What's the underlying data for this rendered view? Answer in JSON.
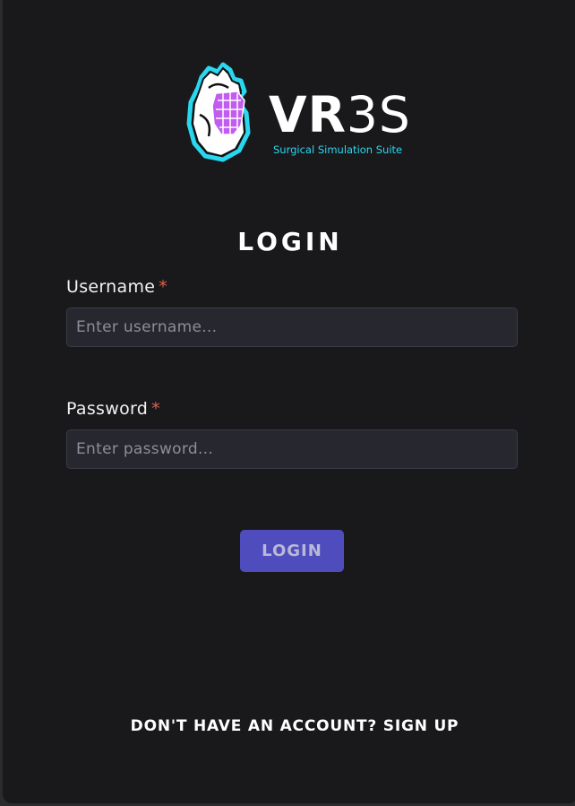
{
  "brand": {
    "logo_main": "VR",
    "logo_number": "3S",
    "tagline": "Surgical Simulation Suite",
    "accent_color": "#29d8f0",
    "heart_color": "#c25bf0"
  },
  "form": {
    "title": "LOGIN",
    "username": {
      "label": "Username",
      "required_mark": "*",
      "placeholder": "Enter username...",
      "value": ""
    },
    "password": {
      "label": "Password",
      "required_mark": "*",
      "placeholder": "Enter password...",
      "value": ""
    },
    "submit_label": "LOGIN",
    "signup_link": "DON'T HAVE AN ACCOUNT? SIGN UP"
  },
  "colors": {
    "background": "#19191b",
    "button": "#4f4dbe",
    "required": "#e0604f"
  }
}
